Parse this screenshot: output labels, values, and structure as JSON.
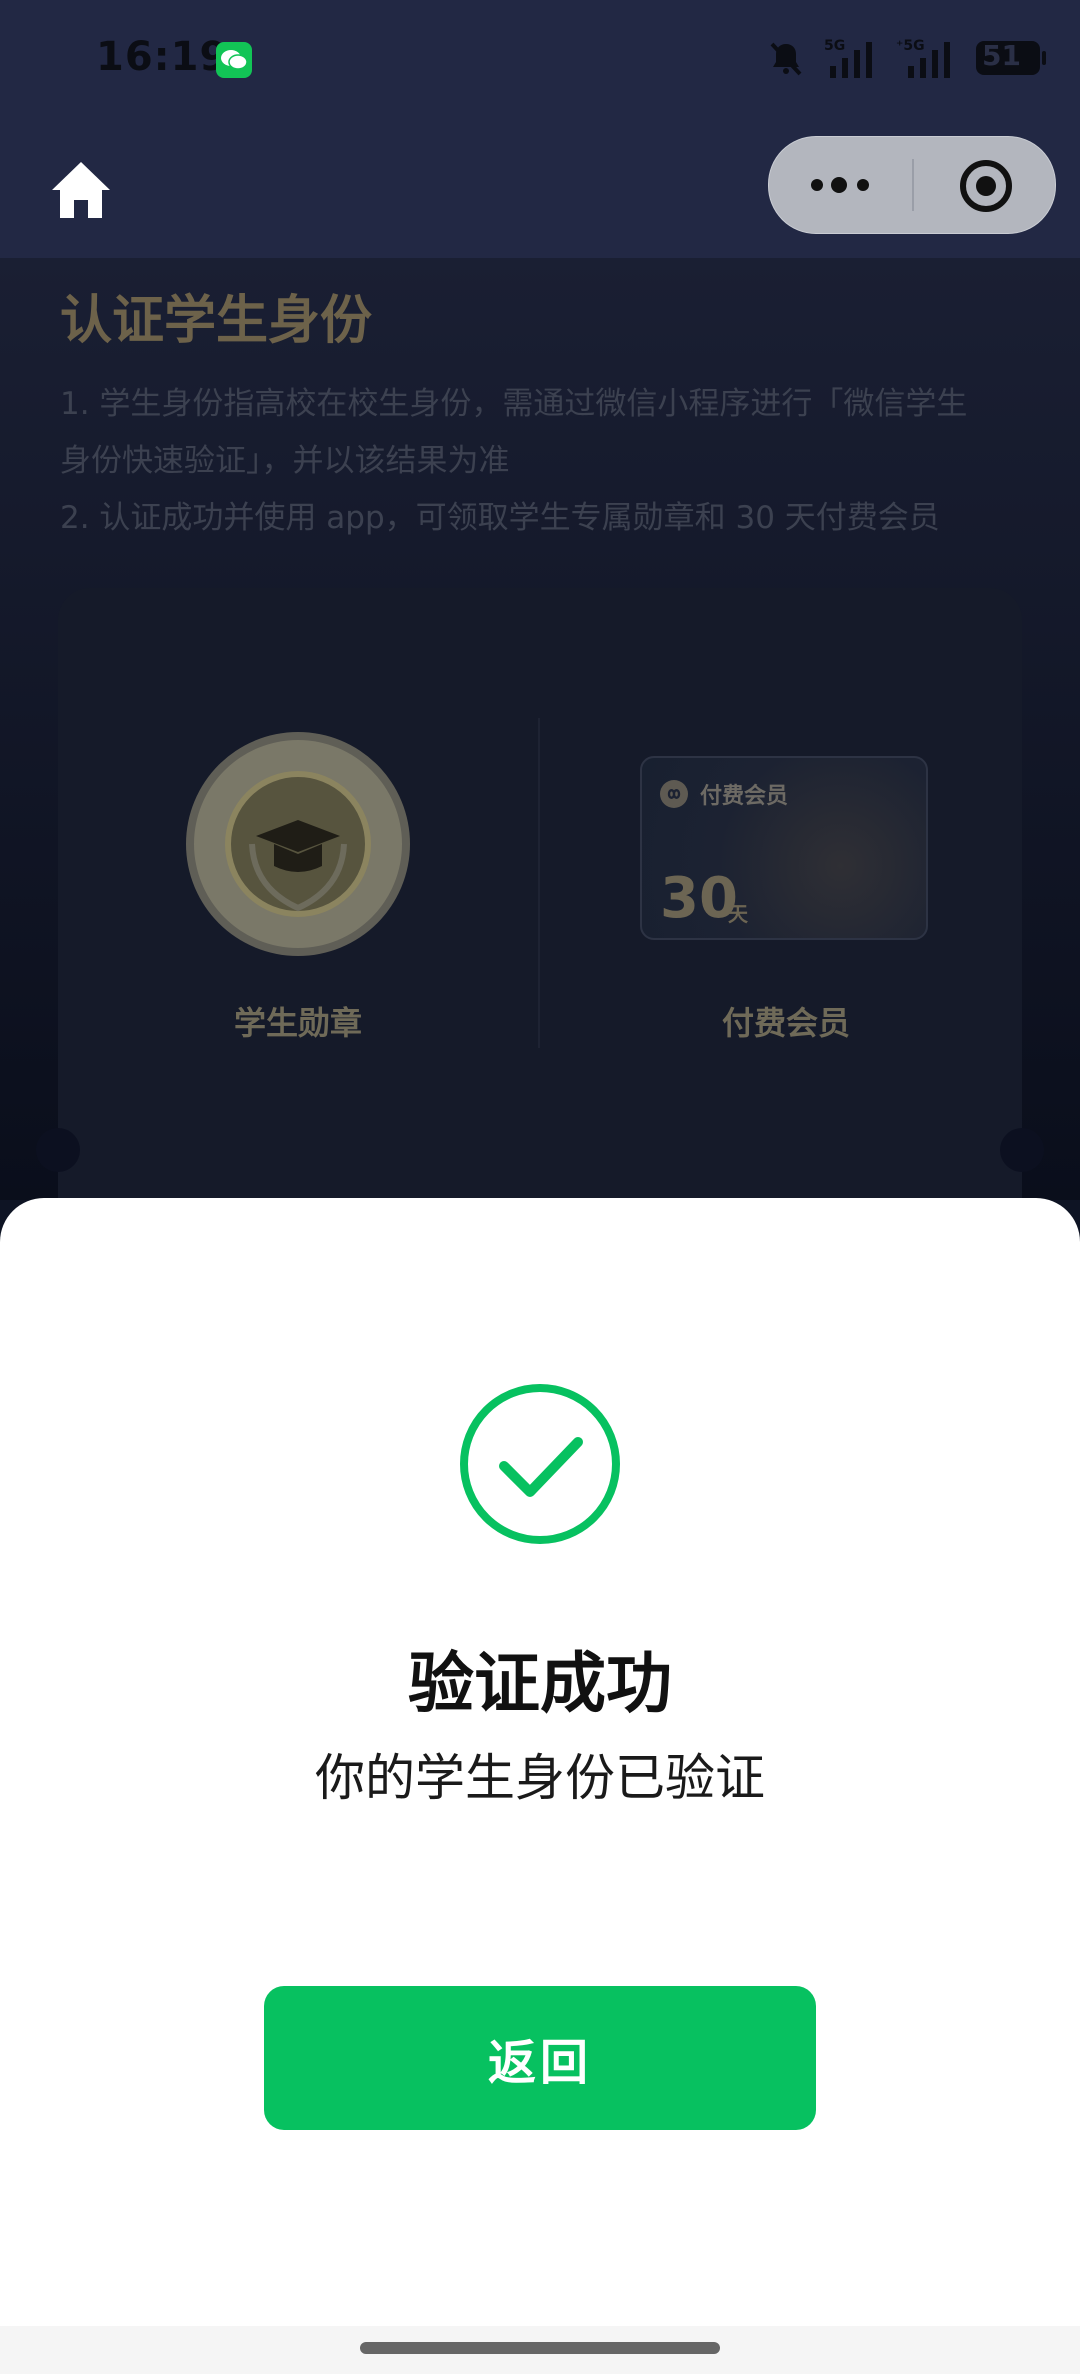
{
  "status_bar": {
    "time": "16:19",
    "battery": "51",
    "icons": [
      "wechat-icon",
      "mute-bell-icon",
      "signal-5g-icon",
      "signal-5g-icon",
      "battery-icon"
    ]
  },
  "nav": {
    "home_icon": "home-icon",
    "more_icon": "more-dots-icon",
    "close_icon": "target-circle-icon"
  },
  "page": {
    "title": "认证学生身份",
    "desc_line1": "1. 学生身份指高校在校生身份，需通过微信小程序进行「微信学生",
    "desc_line2": "身份快速验证」，并以该结果为准",
    "desc_line3": "2. 认证成功并使用 app，可领取学生专属勋章和 30 天付费会员",
    "medal_label": "学生勋章",
    "vip_card_name": "付费会员",
    "vip_days": "30",
    "vip_unit": "天",
    "vip_label": "付费会员"
  },
  "sheet": {
    "title": "验证成功",
    "subtitle": "你的学生身份已验证",
    "back_label": "返回"
  },
  "colors": {
    "accent_green": "#07c160",
    "nav_bg": "#222844"
  }
}
